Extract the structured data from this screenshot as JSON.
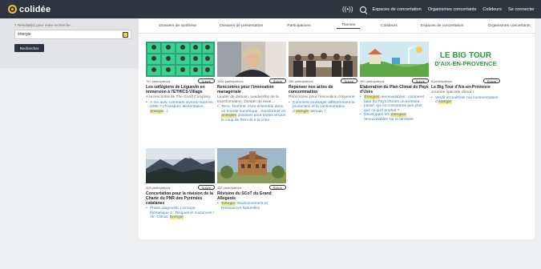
{
  "header": {
    "brand": "colidée",
    "nav": [
      "Espaces de concertation",
      "Organismes concertants",
      "Colideurs",
      "Se connecter"
    ],
    "icons": [
      "broadcast-icon",
      "search-icon"
    ]
  },
  "sidebar": {
    "results_label": "7 Résultat(s) pour votre recherche :",
    "search_value": "énergie",
    "search_button": "Rechercher"
  },
  "tabs": [
    "Dossiers de synthèse",
    "Dossiers de présentation",
    "Participations",
    "Themes",
    "Colideurs",
    "Espaces de concertation",
    "Organismes concertants"
  ],
  "active_tab": "Themes",
  "follow_label": "Suivre",
  "cards": [
    {
      "count": "702 participations",
      "title": "Les collégiens de Léguevin en immersion à l'ETHICS Village",
      "subtitle": "A la rencontre de The Good Company",
      "bullets": [
        [
          "À ton avis, comment vivrons-nous en 2050 ? (Transport, alimentation, ",
          "énergie",
          "...)"
        ]
      ]
    },
    {
      "count": "1060 participations",
      "title": "Rencontres pour l'innovation managériale",
      "subtitle": "Leader de demain, Leadership de la transformation, Donner du sens...",
      "bullets": [
        [
          "Terre, Homme, vivre ensemble dans un monde numérique : transformer en ",
          "énergies",
          " positives pour toutes et tous le coup de frein dû à la crise"
        ]
      ]
    },
    {
      "count": "286 participations",
      "title": "Repenser nos actes de consommation",
      "subtitle": "Rencontres pour l'innovation citoyenne",
      "bullets": [
        [
          "Comment envisager différemment la production et la consommation d'",
          "énergie",
          " demain ?"
        ]
      ]
    },
    {
      "count": "460 participations",
      "title": "Elaboration du Plan Climat du Pays d'Uzès",
      "subtitle": "",
      "bullets": [
        [
          "",
          "Énergies",
          " renouvelables : comment faire du Pays d'Uzès un territoire passif, qui ne consomme pas plus que ce qu'il produit ?"
        ],
        [
          "Développer les ",
          "énergies",
          " renouvelables sur le territoire"
        ]
      ]
    },
    {
      "count": "8 participations",
      "title": "Le Big Tour d'Aix-en-Provence",
      "subtitle": "Journée spéciale climat !",
      "bullets": [
        [
          "Verdir et maîtriser ma consommation d'",
          "énergie",
          ""
        ]
      ],
      "logo_lines": [
        "LE BIG TOUR",
        "D'AIX-EN-PROVENCE"
      ]
    },
    {
      "count": "608 participations",
      "title": "Concertation pour la révision de la Charte du PNR des Pyrénées catalanes",
      "subtitle": "",
      "bullets": [
        [
          "Phase diagnostic / Groupe thématique 3 : Risques et nuisances / Air, Climat, ",
          "Énergie",
          ""
        ]
      ]
    },
    {
      "count": "332 participations",
      "title": "Révision du SCoT du Grand Albigeois",
      "subtitle": "",
      "bullets": [
        [
          "",
          "Énergie",
          ", Environnement et Ressources Naturelles"
        ]
      ]
    }
  ],
  "colors": {
    "header_bg": "#2e3440",
    "accent": "#f2c531",
    "highlight": "#f7e77a",
    "link": "#2f7fbf"
  }
}
